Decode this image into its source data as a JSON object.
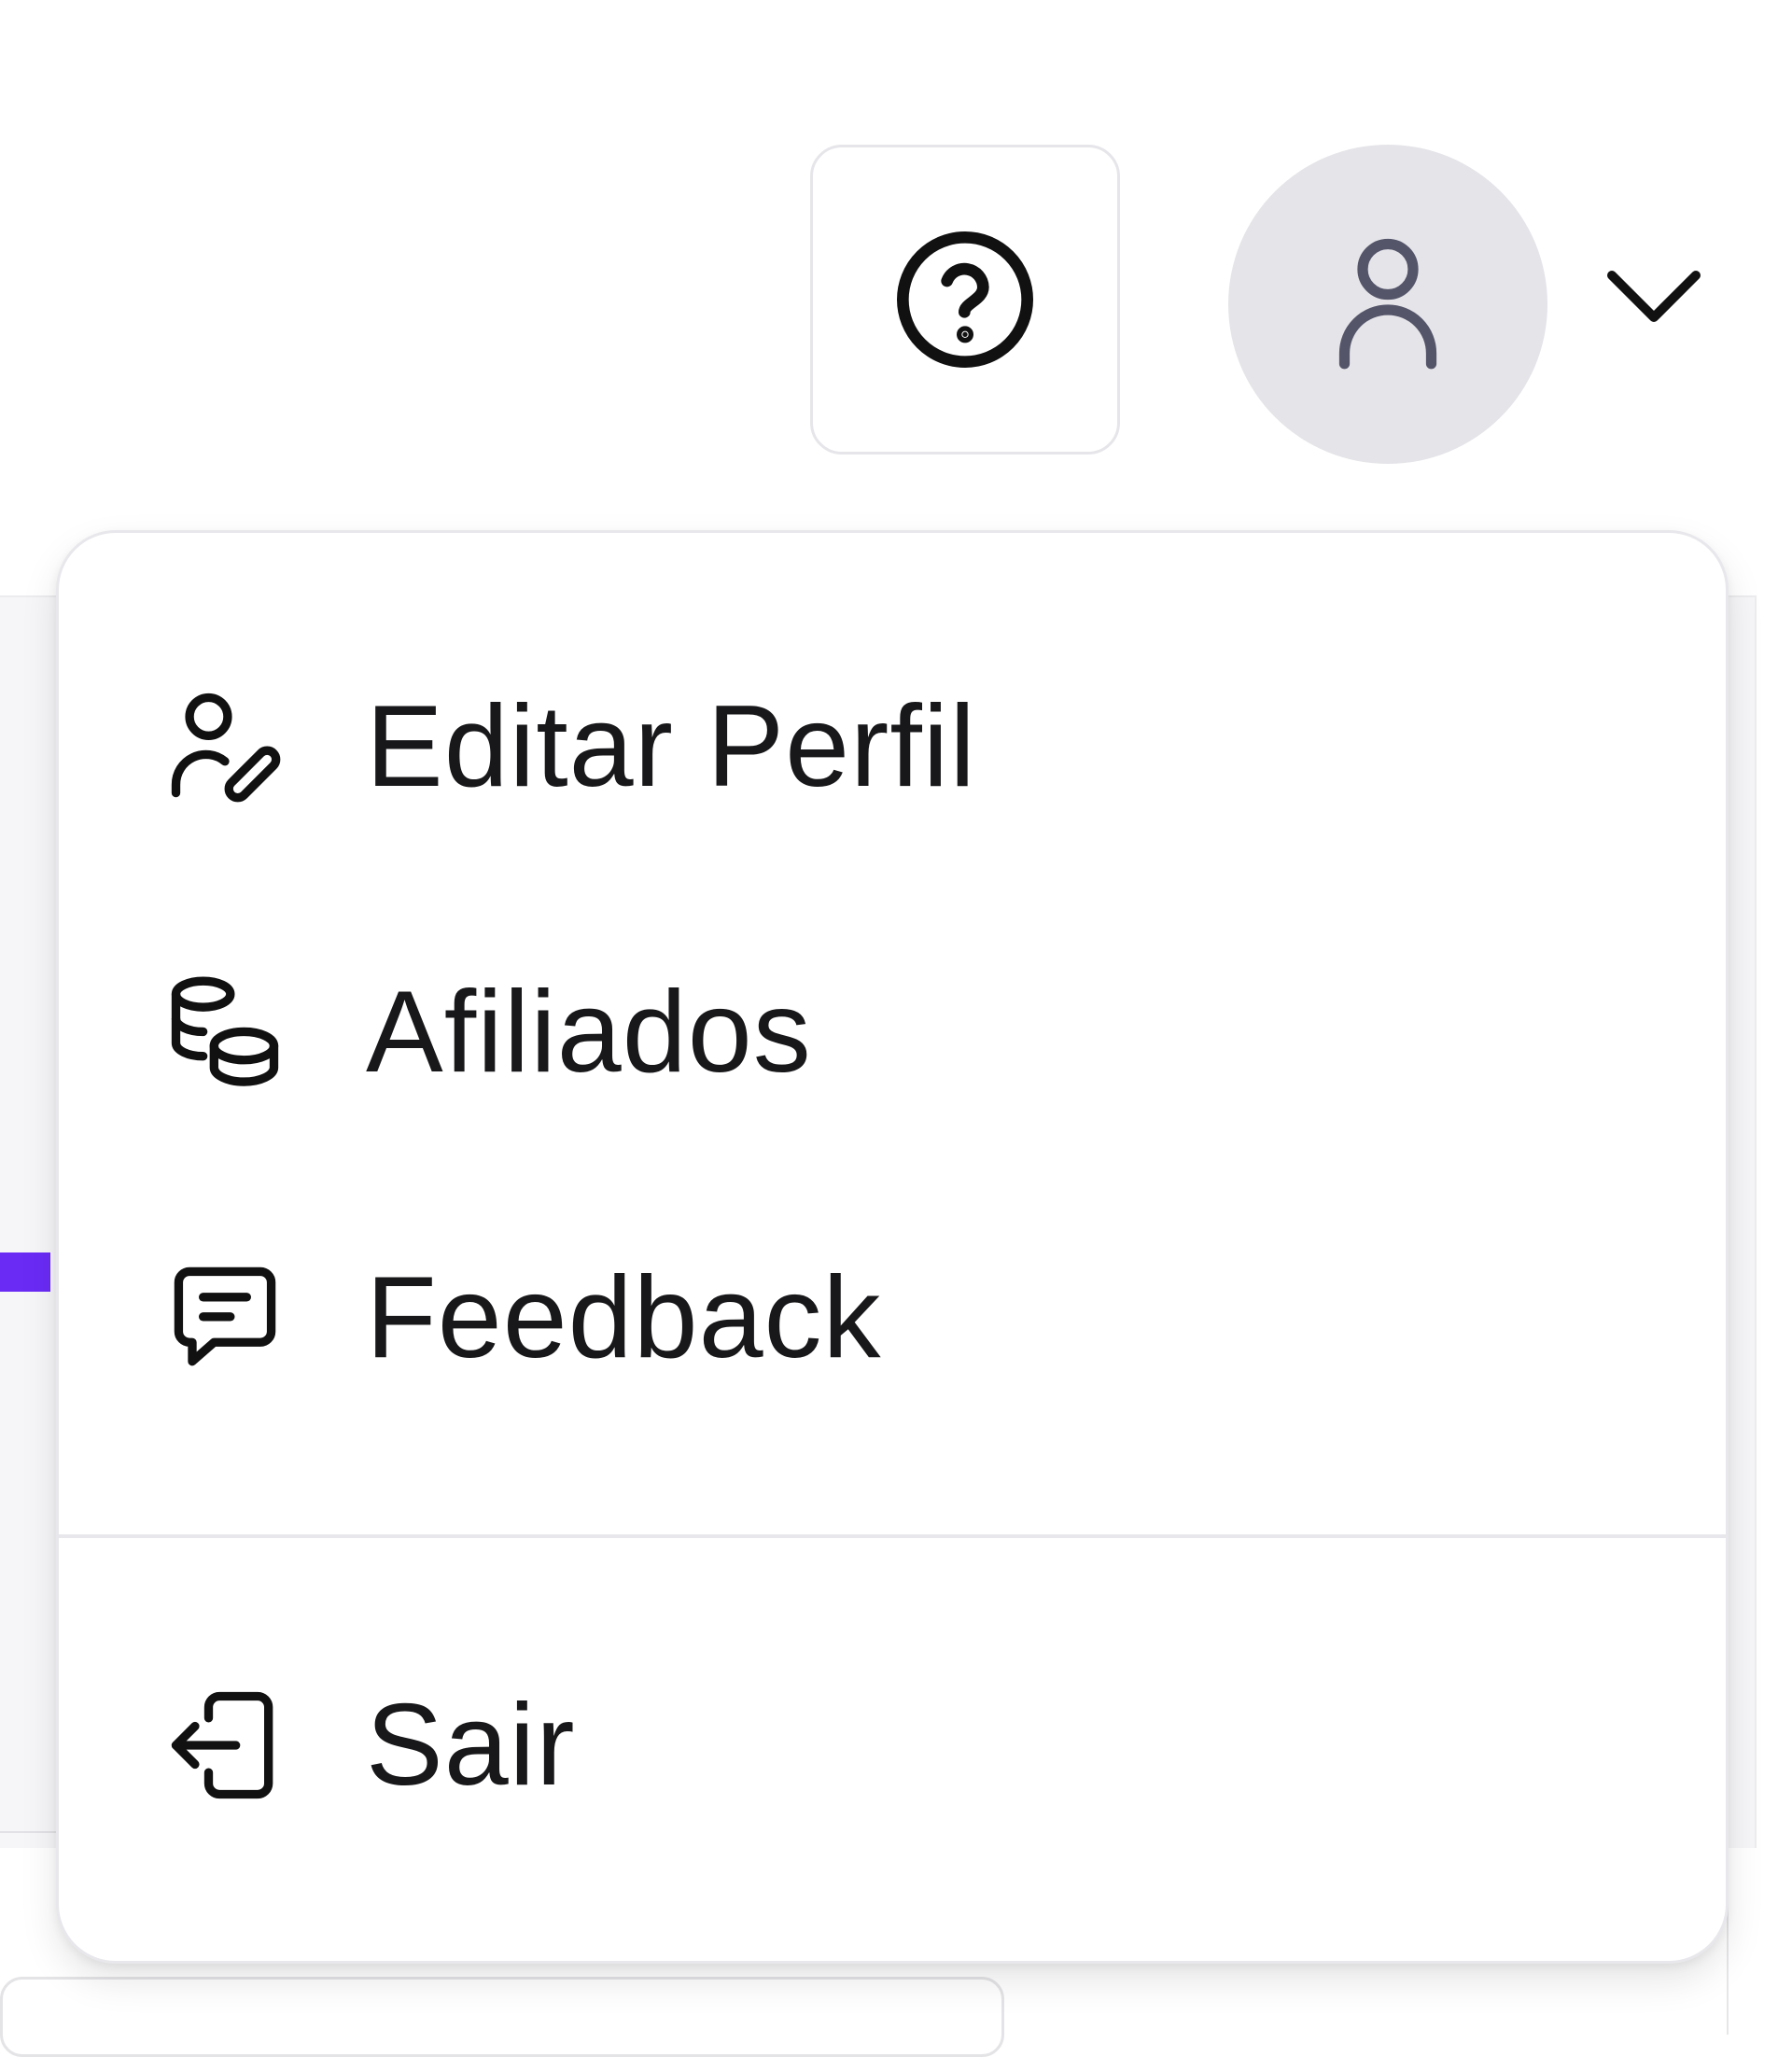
{
  "header": {
    "help_icon": "help-circle-icon",
    "avatar_icon": "user-icon",
    "menu_toggle_icon": "chevron-down-icon"
  },
  "user_menu": {
    "items": [
      {
        "label": "Editar Perfil",
        "icon": "user-edit-icon"
      },
      {
        "label": "Afiliados",
        "icon": "coins-icon"
      },
      {
        "label": "Feedback",
        "icon": "message-square-icon"
      }
    ],
    "logout": {
      "label": "Sair",
      "icon": "log-out-icon"
    }
  },
  "colors": {
    "accent": "#6A2BF5",
    "avatar_bg": "#E4E4E9",
    "text": "#18181B",
    "border": "#E8E8EC"
  }
}
